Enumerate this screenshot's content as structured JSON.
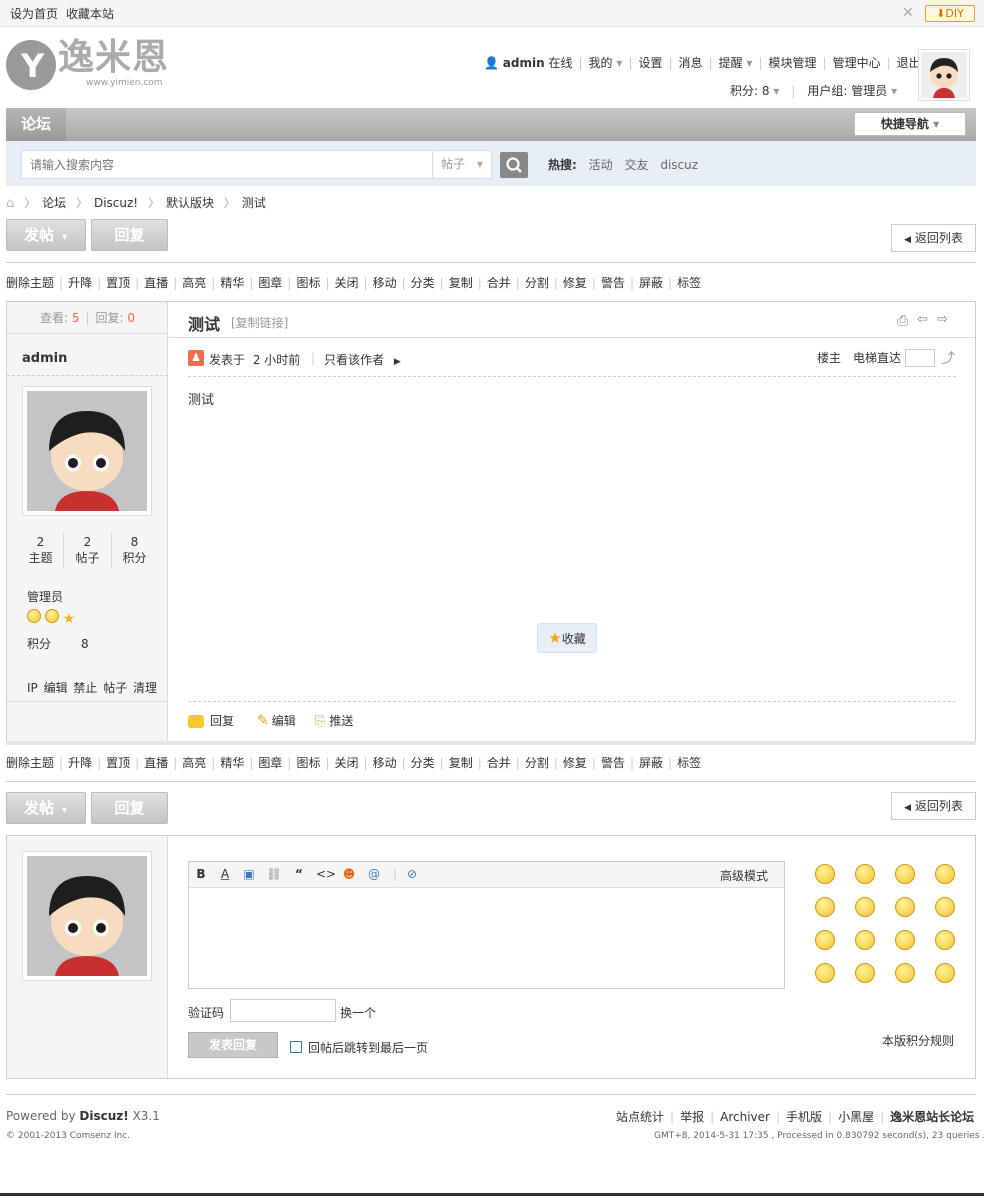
{
  "topbar": {
    "set_home": "设为首页",
    "bookmark": "收藏本站",
    "diy": "DIY"
  },
  "logo": {
    "text": "逸米恩",
    "url_text": "www.yimien.com"
  },
  "user": {
    "name": "admin",
    "status": "在线",
    "my": "我的",
    "settings": "设置",
    "messages": "消息",
    "reminder": "提醒",
    "block_manage": "模块管理",
    "admin_center": "管理中心",
    "logout": "退出",
    "points": "积分: 8",
    "group": "用户组: 管理员"
  },
  "nav": {
    "forum": "论坛",
    "quick_nav": "快捷导航"
  },
  "search": {
    "placeholder": "请输入搜索内容",
    "type": "帖子",
    "hot_label": "热搜:",
    "hot": [
      "活动",
      "交友",
      "discuz"
    ]
  },
  "breadcrumb": [
    "论坛",
    "Discuz!",
    "默认版块",
    "测试"
  ],
  "buttons": {
    "post": "发帖",
    "reply": "回复",
    "back": "返回列表"
  },
  "mod_actions": [
    "删除主题",
    "升降",
    "置顶",
    "直播",
    "高亮",
    "精华",
    "图章",
    "图标",
    "关闭",
    "移动",
    "分类",
    "复制",
    "合并",
    "分割",
    "修复",
    "警告",
    "屏蔽",
    "标签"
  ],
  "thread": {
    "views_label": "查看:",
    "views": "5",
    "replies_label": "回复:",
    "replies": "0",
    "title": "测试",
    "copy_link": "[复制链接]",
    "posted_at": "发表于",
    "time": "2 小时前",
    "only_author": "只看该作者",
    "floor": "楼主",
    "jump": "电梯直达",
    "content": "测试",
    "favorite": "收藏",
    "actions": {
      "reply": "回复",
      "edit": "编辑",
      "push": "推送"
    }
  },
  "author": {
    "name": "admin",
    "stats": [
      {
        "value": "2",
        "label": "主题"
      },
      {
        "value": "2",
        "label": "帖子"
      },
      {
        "value": "8",
        "label": "积分"
      }
    ],
    "group": "管理员",
    "points_label": "积分",
    "points": "8",
    "tools": "IP 编辑 禁止 帖子 清理"
  },
  "editor": {
    "advanced": "高级模式",
    "captcha_label": "验证码",
    "captcha_change": "换一个",
    "submit": "发表回复",
    "jump_last": "回帖后跳转到最后一页",
    "rules": "本版积分规则"
  },
  "footer": {
    "powered": "Powered by",
    "brand": "Discuz!",
    "version": "X3.1",
    "copyright": "© 2001-2013 Comsenz Inc.",
    "links": [
      "站点统计",
      "举报",
      "Archiver",
      "手机版",
      "小黑屋"
    ],
    "site": "逸米恩站长论坛",
    "runtime": "GMT+8, 2014-5-31 17:35 , Processed in 0.830792 second(s), 23 queries ."
  },
  "colors": {
    "accent": "#f26c4f",
    "nav": "#b0b0b0",
    "search_bg": "#e8eef5"
  }
}
